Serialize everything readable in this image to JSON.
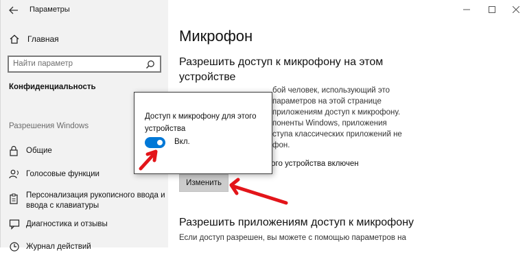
{
  "window": {
    "title": "Параметры",
    "back_icon": "arrow-left-icon",
    "controls": [
      "minimize-icon",
      "maximize-icon",
      "close-icon"
    ]
  },
  "sidebar": {
    "home_label": "Главная",
    "search_placeholder": "Найти параметр",
    "section_title": "Конфиденциальность",
    "group_label": "Разрешения Windows",
    "items": [
      {
        "label": "Общие",
        "icon": "lock-icon"
      },
      {
        "label": "Голосовые функции",
        "icon": "person-speech-icon"
      },
      {
        "label": "Персонализация рукописного ввода и ввода с клавиатуры",
        "line1": "Персонализация рукописного ввода и",
        "line2": "ввода с клавиатуры",
        "icon": "clipboard-icon"
      },
      {
        "label": "Диагностика и отзывы",
        "icon": "feedback-icon"
      },
      {
        "label": "Журнал действий",
        "icon": "history-icon"
      }
    ]
  },
  "main": {
    "page_title": "Микрофон",
    "heading1_line1": "Разрешить доступ к микрофону на этом",
    "heading1_line2": "устройстве",
    "desc_visible": [
      "бой человек, использующий это",
      "параметров на этой странице",
      "приложениям доступ к микрофону.",
      "поненты Windows, приложения",
      "ступа классических приложений не",
      "фон."
    ],
    "status_fragment": "того устройства включен",
    "change_button": "Изменить",
    "heading2": "Разрешить приложениям доступ к микрофону",
    "desc2_visible": "Если доступ разрешен, вы можете с помощью параметров на"
  },
  "popup": {
    "title": "Доступ к микрофону для этого устройства",
    "toggle_state": "Вкл.",
    "toggle_on": true,
    "accent_color": "#0078d7"
  },
  "annotations": {
    "arrow_color": "#e3151a"
  }
}
